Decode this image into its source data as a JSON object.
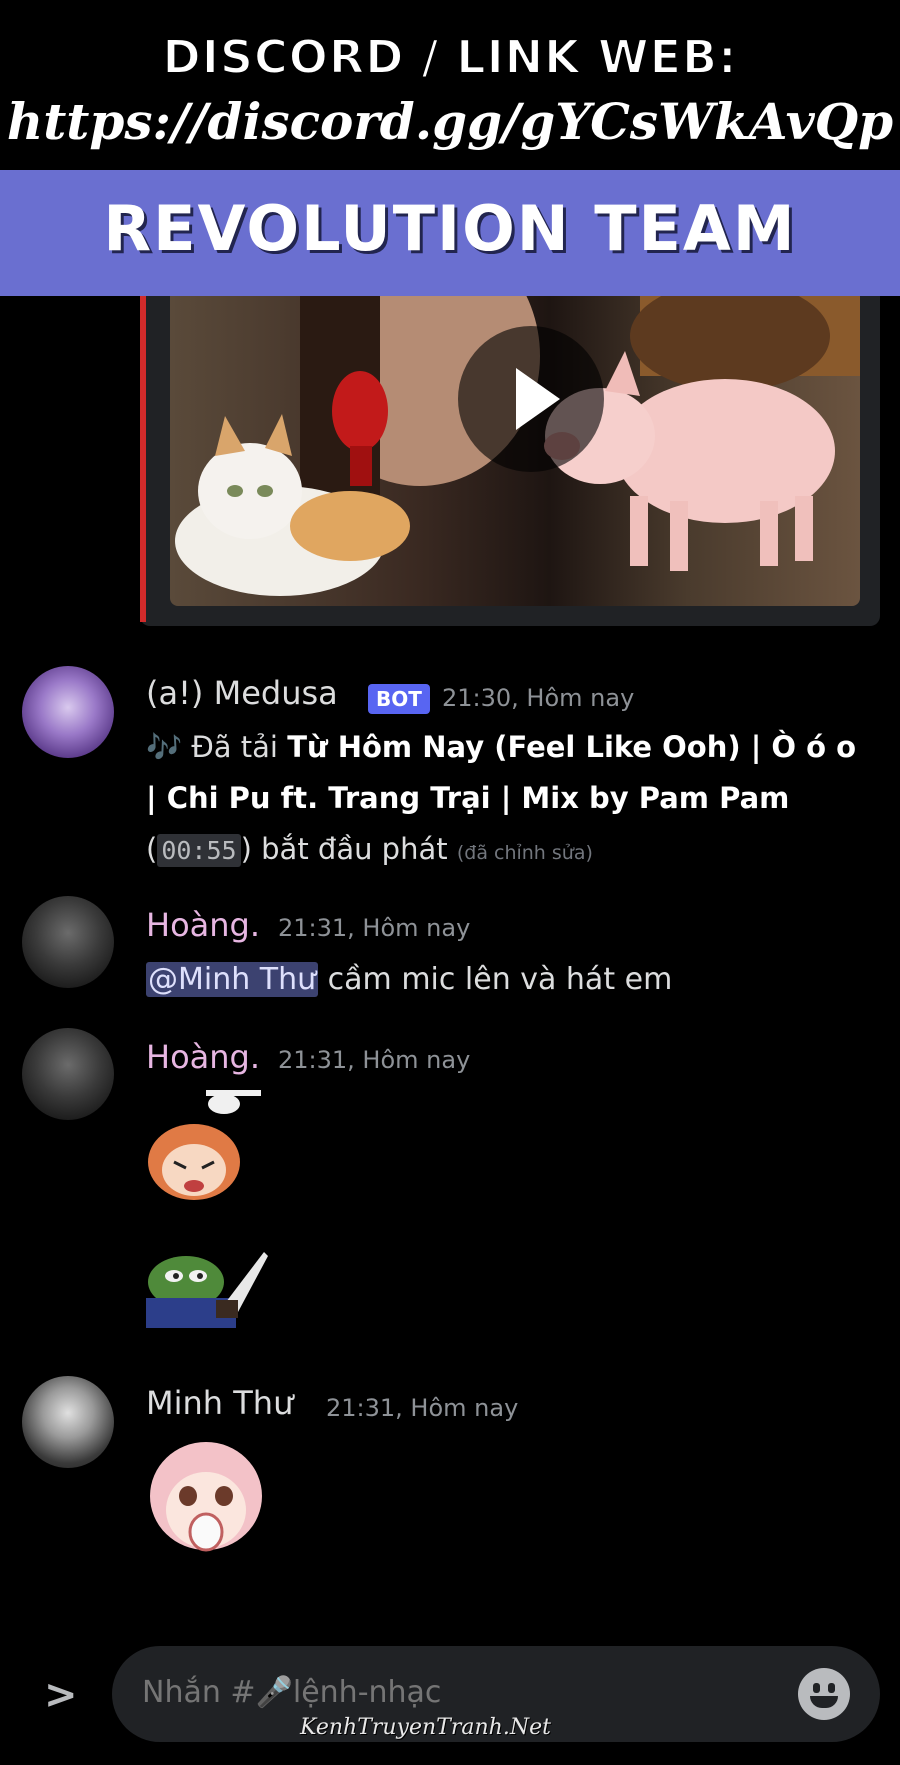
{
  "banner": {
    "line1": "DISCORD / LINK WEB:",
    "line2": "https://discord.gg/gYCsWkAvQp",
    "team": "REVOLUTION TEAM"
  },
  "messages": [
    {
      "username": "(a!) Medusa",
      "username_color": "#dcddde",
      "bot_tag": "BOT",
      "timestamp": "21:30, Hôm nay",
      "text_prefix": "🎶 Đã tải ",
      "song": "Từ Hôm Nay (Feel Like Ooh) | Ò ó o | Chi Pu ft. Trang Trại | Mix by Pam Pam",
      "duration": "00:55",
      "text_suffix": "bắt đầu phát",
      "edited": "(đã chỉnh sửa)"
    },
    {
      "username": "Hoàng.",
      "username_color": "#e7b6e2",
      "timestamp": "21:31, Hôm nay",
      "mention": "@Minh Thư",
      "text": " cầm mic lên và hát em"
    },
    {
      "username": "Hoàng.",
      "username_color": "#e7b6e2",
      "timestamp": "21:31, Hôm nay"
    },
    {
      "username": "Minh Thư",
      "username_color": "#dcddde",
      "timestamp": "21:31, Hôm nay"
    }
  ],
  "composer": {
    "placeholder": "Nhắn #🎤lệnh-nhạc"
  },
  "expand_label": ">",
  "watermark": "KenhTruyenTranh.Net",
  "colors": {
    "banner_bg": "#6a6fd0",
    "embed_accent": "#d12b2b",
    "bot_tag": "#5865f2",
    "mention_bg": "#3c4270"
  }
}
